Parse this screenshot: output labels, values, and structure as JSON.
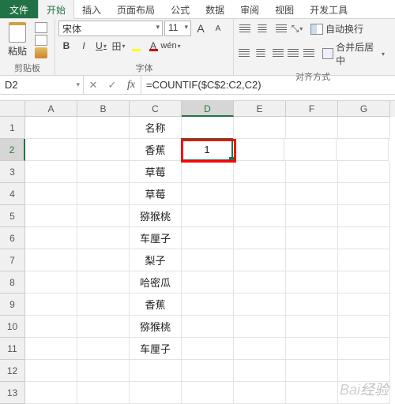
{
  "tabs": {
    "file": "文件",
    "home": "开始",
    "insert": "插入",
    "layout": "页面布局",
    "formula": "公式",
    "data": "数据",
    "review": "审阅",
    "view": "视图",
    "dev": "开发工具"
  },
  "ribbon": {
    "clipboard": {
      "paste": "粘贴",
      "label": "剪贴板"
    },
    "font": {
      "name": "宋体",
      "size": "11",
      "increase": "A",
      "decrease": "A",
      "bold": "B",
      "italic": "I",
      "underline": "U",
      "border": "田",
      "fill": "A",
      "fontcolor": "A",
      "wen": "wén",
      "label": "字体"
    },
    "align": {
      "wrap": "自动换行",
      "merge": "合并后居中",
      "label": "对齐方式"
    }
  },
  "formula_bar": {
    "cell_ref": "D2",
    "cancel": "✕",
    "confirm": "✓",
    "fx": "fx",
    "formula": "=COUNTIF($C$2:C2,C2)"
  },
  "columns": [
    "A",
    "B",
    "C",
    "D",
    "E",
    "F",
    "G"
  ],
  "selected_col_index": 3,
  "selected_row_index": 1,
  "rows": [
    {
      "n": "1",
      "c": "名称",
      "d": ""
    },
    {
      "n": "2",
      "c": "香蕉",
      "d": "1"
    },
    {
      "n": "3",
      "c": "草莓",
      "d": ""
    },
    {
      "n": "4",
      "c": "草莓",
      "d": ""
    },
    {
      "n": "5",
      "c": "猕猴桃",
      "d": ""
    },
    {
      "n": "6",
      "c": "车厘子",
      "d": ""
    },
    {
      "n": "7",
      "c": "梨子",
      "d": ""
    },
    {
      "n": "8",
      "c": "哈密瓜",
      "d": ""
    },
    {
      "n": "9",
      "c": "香蕉",
      "d": ""
    },
    {
      "n": "10",
      "c": "猕猴桃",
      "d": ""
    },
    {
      "n": "11",
      "c": "车厘子",
      "d": ""
    },
    {
      "n": "12",
      "c": "",
      "d": ""
    },
    {
      "n": "13",
      "c": "",
      "d": ""
    }
  ],
  "watermark": {
    "a": "Bai",
    "b": "经验"
  }
}
